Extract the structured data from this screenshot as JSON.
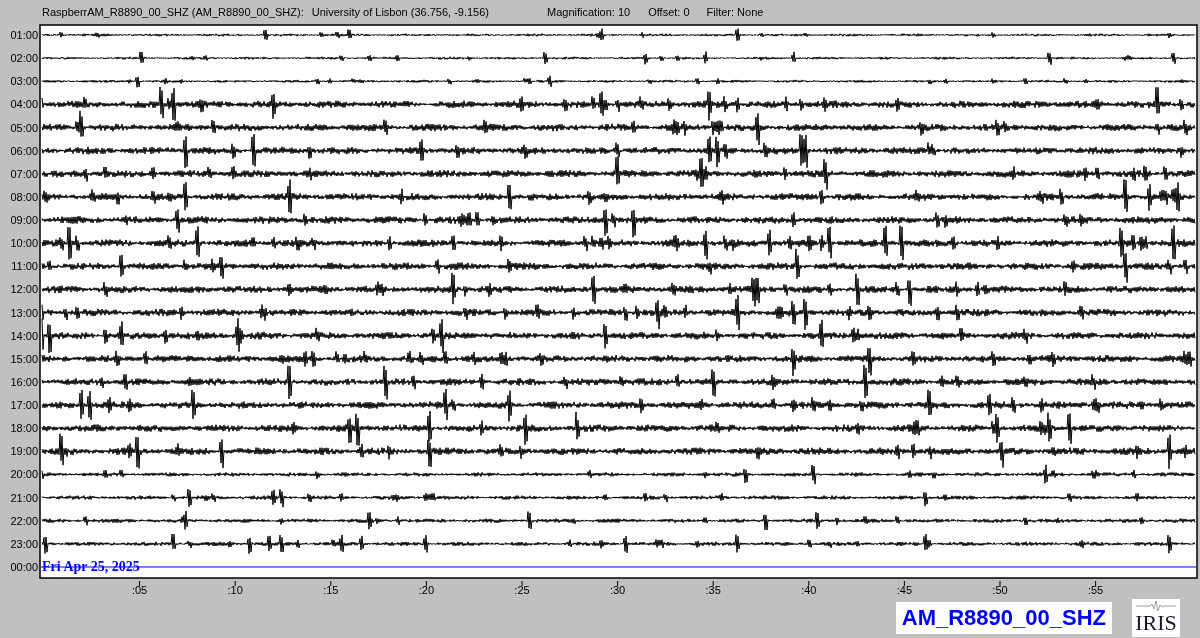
{
  "header": {
    "station": "RaspberrAM_R8890_00_SHZ (AM_R8890_00_SHZ):",
    "location": "University of Lisbon (36.756, -9.156)",
    "magnification": "Magnification: 10",
    "offset": "Offset: 0",
    "filter": "Filter: None"
  },
  "rows": [
    {
      "time": "01:00",
      "kind": "trace"
    },
    {
      "time": "02:00",
      "kind": "trace"
    },
    {
      "time": "03:00",
      "kind": "trace"
    },
    {
      "time": "04:00",
      "kind": "trace"
    },
    {
      "time": "05:00",
      "kind": "trace"
    },
    {
      "time": "06:00",
      "kind": "trace"
    },
    {
      "time": "07:00",
      "kind": "trace"
    },
    {
      "time": "08:00",
      "kind": "trace"
    },
    {
      "time": "09:00",
      "kind": "trace"
    },
    {
      "time": "10:00",
      "kind": "trace"
    },
    {
      "time": "11:00",
      "kind": "trace"
    },
    {
      "time": "12:00",
      "kind": "trace"
    },
    {
      "time": "13:00",
      "kind": "trace"
    },
    {
      "time": "14:00",
      "kind": "trace"
    },
    {
      "time": "15:00",
      "kind": "trace"
    },
    {
      "time": "16:00",
      "kind": "trace"
    },
    {
      "time": "17:00",
      "kind": "trace"
    },
    {
      "time": "18:00",
      "kind": "trace"
    },
    {
      "time": "19:00",
      "kind": "trace"
    },
    {
      "time": "20:00",
      "kind": "trace"
    },
    {
      "time": "21:00",
      "kind": "trace"
    },
    {
      "time": "22:00",
      "kind": "trace"
    },
    {
      "time": "23:00",
      "kind": "trace"
    },
    {
      "time": "00:00",
      "kind": "current"
    }
  ],
  "date_label": "Fri Apr 25, 2025",
  "x_ticks": [
    ":05",
    ":10",
    ":15",
    ":20",
    ":25",
    ":30",
    ":35",
    ":40",
    ":45",
    ":50",
    ":55"
  ],
  "station_label": "AM_R8890_00_SHZ",
  "logo_text": "IRIS"
}
